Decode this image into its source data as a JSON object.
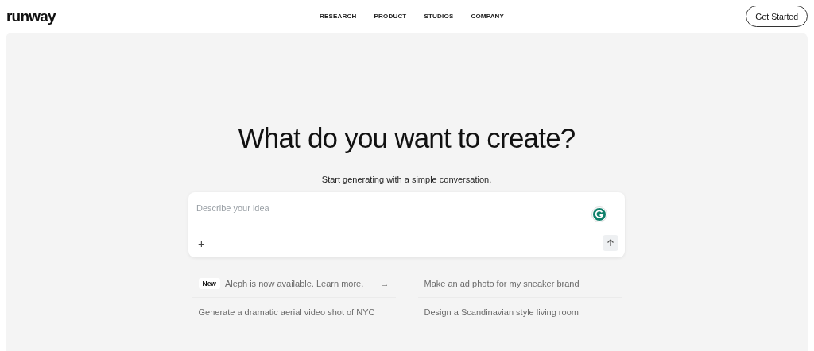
{
  "logo": "runway",
  "nav": [
    {
      "label": "RESEARCH"
    },
    {
      "label": "PRODUCT"
    },
    {
      "label": "STUDIOS"
    },
    {
      "label": "COMPANY"
    }
  ],
  "cta": "Get Started",
  "heading": "What do you want to create?",
  "subheading": "Start generating with a simple conversation.",
  "prompt": {
    "placeholder": "Describe your idea",
    "add": "+"
  },
  "suggestions": [
    {
      "kind": "announcement",
      "badge": "New",
      "text": "Aleph is now available. Learn more.",
      "arrow": "→"
    },
    {
      "kind": "prompt",
      "text": "Make an ad photo for my sneaker brand"
    },
    {
      "kind": "prompt",
      "text": "Generate a dramatic aerial video shot of NYC"
    },
    {
      "kind": "prompt",
      "text": "Design a Scandinavian style living room"
    }
  ]
}
